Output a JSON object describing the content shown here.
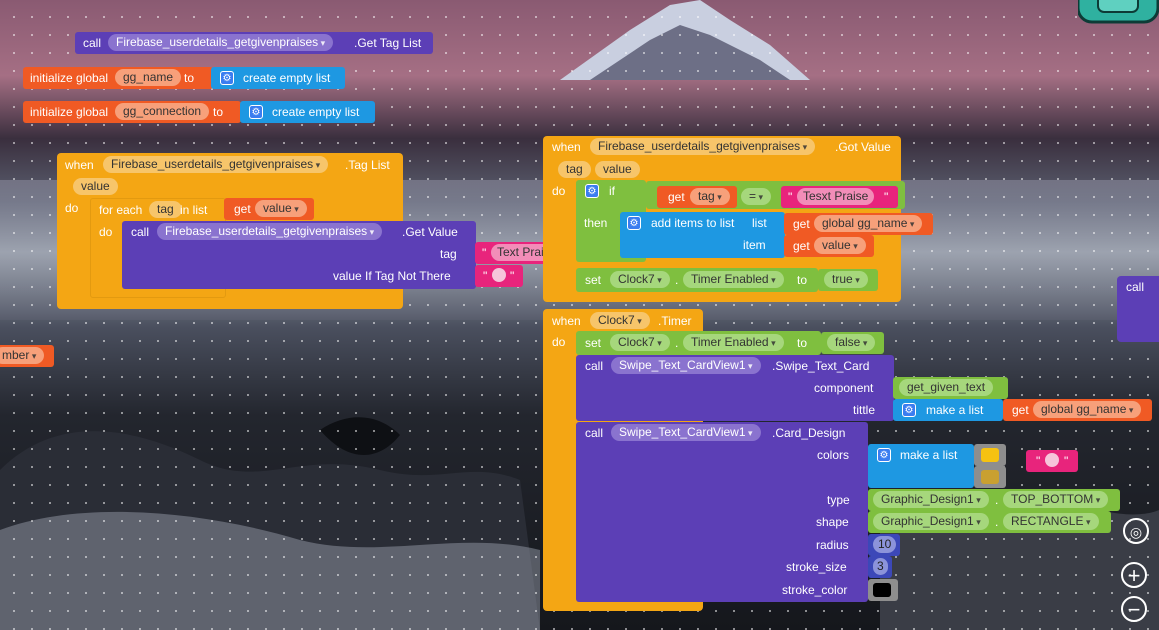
{
  "blocks": {
    "call_get_tag_list": {
      "call": "call",
      "component": "Firebase_userdetails_getgivenpraises",
      "method": ".Get Tag List"
    },
    "init_gg_name": {
      "label": "initialize global",
      "var": "gg_name",
      "to": "to",
      "value": "create empty list"
    },
    "init_gg_connection": {
      "label": "initialize global",
      "var": "gg_connection",
      "to": "to",
      "value": "create empty list"
    },
    "when_tag_list": {
      "when": "when",
      "component": "Firebase_userdetails_getgivenpraises",
      "event": ".Tag List",
      "param": "value",
      "do": "do",
      "foreach": "for each",
      "item_var": "tag",
      "in_list": "in list",
      "get": "get",
      "get_var": "value",
      "inner_do": "do",
      "call": "call",
      "call_component": "Firebase_userdetails_getgivenpraises",
      "call_method": ".Get Value",
      "tag_label": "tag",
      "tag_value": "Text Praise",
      "value_if_label": "value If Tag Not There",
      "value_if_text": ""
    },
    "when_got_value": {
      "when": "when",
      "component": "Firebase_userdetails_getgivenpraises",
      "event": ".Got Value",
      "param1": "tag",
      "param2": "value",
      "do": "do",
      "if": "if",
      "get": "get",
      "get_var": "tag",
      "eq": "=",
      "compare_text": "Tesxt Praise",
      "then": "then",
      "add_items": "add items to list",
      "list_label": "list",
      "list_get": "get",
      "list_var": "global gg_name",
      "item_label": "item",
      "item_get": "get",
      "item_var": "value",
      "set": "set",
      "set_component": "Clock7",
      "set_prop": "Timer Enabled",
      "set_to": "to",
      "set_value": "true"
    },
    "when_clock_timer": {
      "when": "when",
      "component": "Clock7",
      "event": ".Timer",
      "do": "do",
      "set": "set",
      "set_component": "Clock7",
      "set_prop": "Timer Enabled",
      "set_to": "to",
      "set_value": "false",
      "call1": "call",
      "call1_component": "Swipe_Text_CardView1",
      "call1_method": ".Swipe_Text_Card",
      "component_label": "component",
      "component_value": "get_given_text",
      "tittle_label": "tittle",
      "make_list": "make a list",
      "tittle_get": "get",
      "tittle_var": "global gg_name",
      "call2": "call",
      "call2_component": "Swipe_Text_CardView1",
      "call2_method": ".Card_Design",
      "colors_label": "colors",
      "colors_make_list": "make a list",
      "colors_text": "",
      "type_label": "type",
      "type_component": "Graphic_Design1",
      "type_value": "TOP_BOTTOM",
      "shape_label": "shape",
      "shape_component": "Graphic_Design1",
      "shape_value": "RECTANGLE",
      "radius_label": "radius",
      "radius_value": "10",
      "stroke_size_label": "stroke_size",
      "stroke_size_value": "3",
      "stroke_color_label": "stroke_color"
    },
    "partial_left": {
      "text": "mber"
    },
    "partial_right": {
      "text": "call"
    }
  },
  "colors": {
    "event": "#f4a614",
    "component_call": "#5c3fb6",
    "variable": "#f05a24",
    "list": "#1e98e2",
    "logic": "#7fbf3f",
    "text": "#e8247c",
    "math": "#3c48b8",
    "color_yellow": "#f5c211",
    "color_gold": "#c9a030",
    "color_black": "#000000"
  },
  "icons": [
    "gear-icon",
    "locate-icon",
    "zoom-in-icon",
    "zoom-out-icon",
    "backpack-icon"
  ]
}
